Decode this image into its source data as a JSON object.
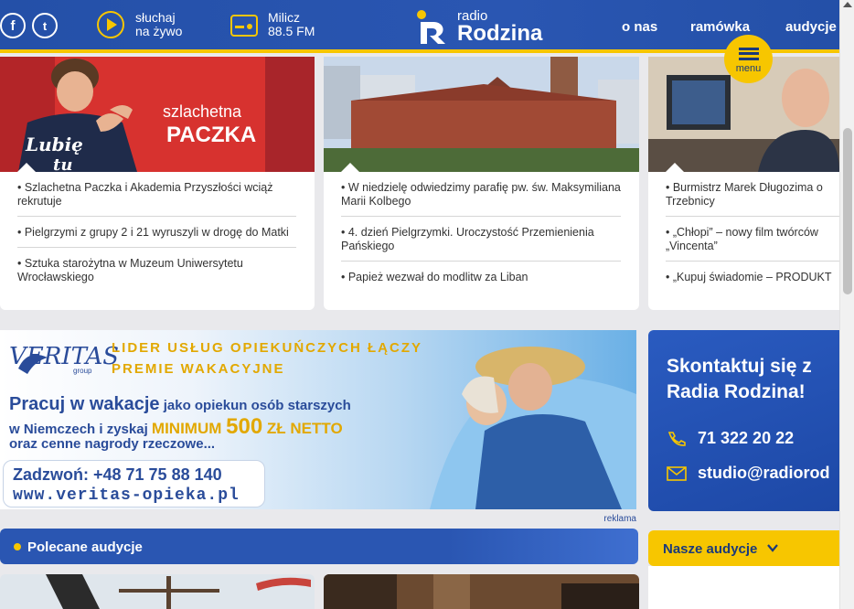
{
  "header": {
    "social": [
      {
        "name": "facebook",
        "glyph": "f"
      },
      {
        "name": "twitter",
        "glyph": "t"
      }
    ],
    "listen_line1": "słuchaj",
    "listen_line2": "na żywo",
    "station_city": "Milicz",
    "station_freq": "88.5 FM",
    "logo_small": "radio",
    "logo_big": "Rodzina",
    "nav": [
      "o nas",
      "ramówka",
      "audycje"
    ],
    "menu_label": "menu"
  },
  "news_columns": [
    {
      "items": [
        "• Szlachetna Paczka i Akademia Przyszłości wciąż rekrutuje",
        "• Pielgrzymi z grupy 2 i 21 wyruszyli w drogę do Matki",
        "• Sztuka starożytna w Muzeum Uniwersytetu Wrocławskiego"
      ]
    },
    {
      "items": [
        "• W niedzielę odwiedzimy parafię pw. św. Maksymiliana Marii Kolbego",
        "• 4. dzień Pielgrzymki. Uroczystość Przemienienia Pańskiego",
        "• Papież wezwał do modlitw za Liban"
      ]
    },
    {
      "items": [
        "• Burmistrz Marek Długozima o Trzebnicy",
        "• „Chłopi” – nowy film twórców „Vincenta”",
        "• „Kupuj świadomie – PRODUKT"
      ]
    }
  ],
  "images": {
    "img1_banner_line1": "szlachetna",
    "img1_banner_line2": "PACZKA",
    "img1_shirt_line1": "Lubię",
    "img1_shirt_line2": "tu"
  },
  "ad": {
    "brand": "VERITAS",
    "brand_sub": "group",
    "headline1": "LIDER USŁUG OPIEKUŃCZYCH ŁĄCZY",
    "headline2": "PREMIE WAKACYJNE",
    "line1_a": "Pracuj w wakacje",
    "line1_b": " jako opiekun osób starszych",
    "line2_a": "w Niemczech i zyskaj ",
    "line2_b": "MINIMUM ",
    "line2_c": "500",
    "line2_d": " ZŁ NETTO",
    "line3": "oraz cenne nagrody rzeczowe...",
    "phone": "Zadzwoń: +48 71 75 88 140",
    "url": "www.veritas-opieka.pl",
    "label": "reklama"
  },
  "contact": {
    "title": "Skontaktuj się z Radia Rodzina!",
    "phone": "71 322 20 22",
    "email": "studio@radiorod"
  },
  "polecane": {
    "title": "Polecane audycje"
  },
  "nasze": {
    "title": "Nasze audycje"
  },
  "colors": {
    "brand_blue": "#2a56b2",
    "accent_yellow": "#f7c600"
  }
}
